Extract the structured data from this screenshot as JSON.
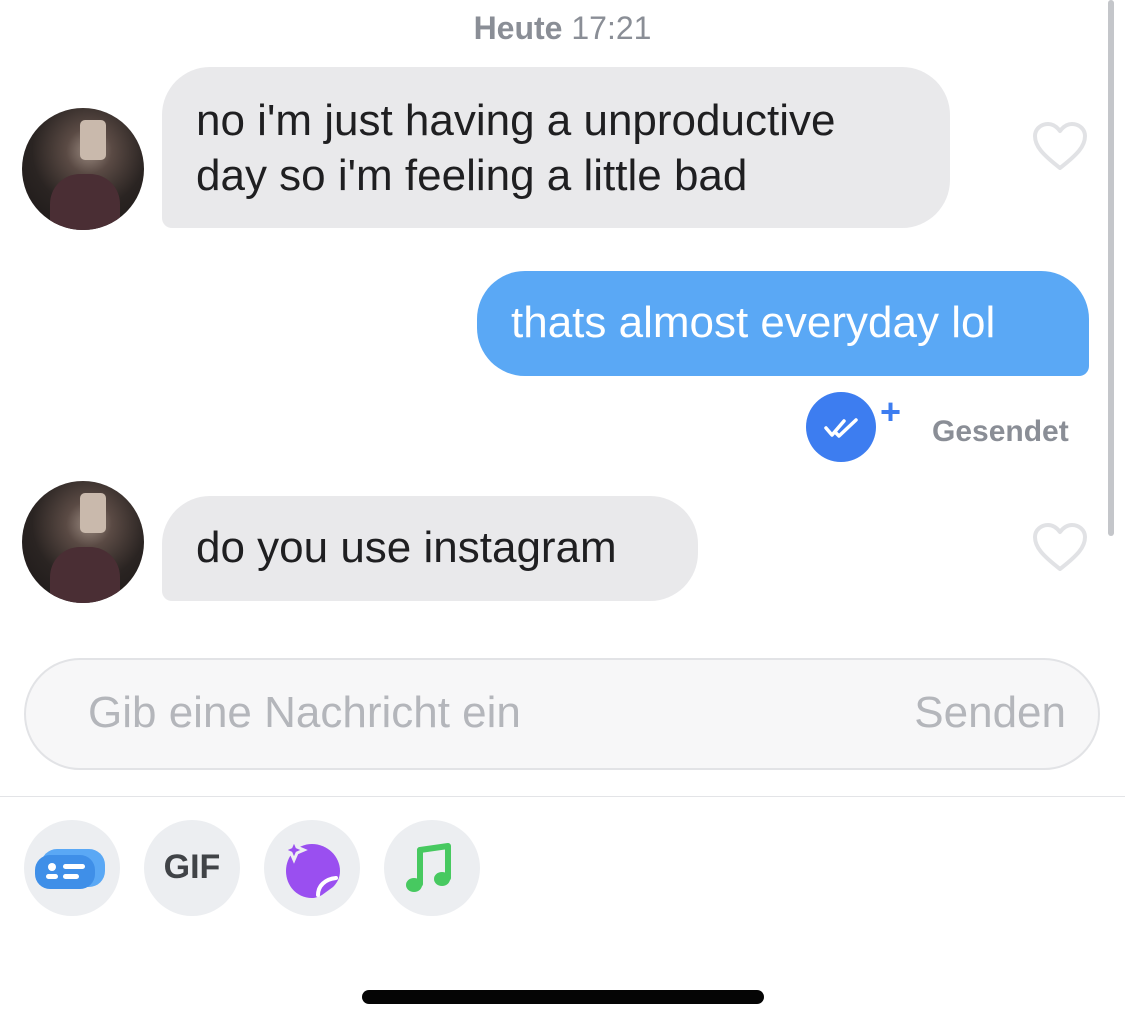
{
  "header": {
    "day_label": "Heute",
    "time_label": "17:21"
  },
  "messages": [
    {
      "direction": "received",
      "line1": "no i'm just having a unproductive",
      "line2": "day so i'm feeling a little bad",
      "liked": false
    },
    {
      "direction": "sent",
      "text": "thats almost everyday lol"
    },
    {
      "direction": "received",
      "text": "do you use instagram",
      "liked": false
    }
  ],
  "delivery": {
    "status_label": "Gesendet",
    "badge_icon": "double-check-icon",
    "plus_mark": "+"
  },
  "composer": {
    "placeholder": "Gib eine Nachricht ein",
    "send_label": "Senden"
  },
  "toolbar": {
    "items": [
      {
        "icon": "contact-card-icon",
        "color": "#5aa8f5"
      },
      {
        "icon": "gif-icon",
        "label": "GIF"
      },
      {
        "icon": "sticker-sparkle-icon",
        "color": "#9a4ff0"
      },
      {
        "icon": "music-note-icon",
        "color": "#47c960"
      }
    ]
  },
  "colors": {
    "sent_bubble": "#5aa8f5",
    "received_bubble": "#e9e9eb",
    "accent_blue": "#3d7df0",
    "muted_text": "#8a8e96"
  }
}
